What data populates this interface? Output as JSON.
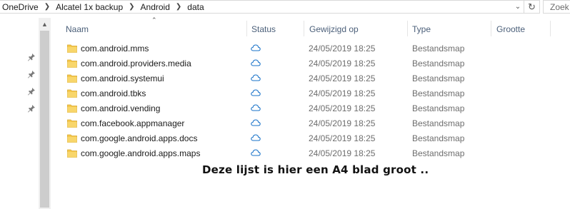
{
  "address": {
    "crumbs": [
      "OneDrive",
      "Alcatel 1x backup",
      "Android",
      "data"
    ]
  },
  "search": {
    "placeholder": "Zoek"
  },
  "columns": {
    "name": "Naam",
    "status": "Status",
    "modified": "Gewijzigd op",
    "type": "Type",
    "size": "Grootte"
  },
  "files": [
    {
      "name": "com.android.mms",
      "modified": "24/05/2019 18:25",
      "type": "Bestandsmap"
    },
    {
      "name": "com.android.providers.media",
      "modified": "24/05/2019 18:25",
      "type": "Bestandsmap"
    },
    {
      "name": "com.android.systemui",
      "modified": "24/05/2019 18:25",
      "type": "Bestandsmap"
    },
    {
      "name": "com.android.tbks",
      "modified": "24/05/2019 18:25",
      "type": "Bestandsmap"
    },
    {
      "name": "com.android.vending",
      "modified": "24/05/2019 18:25",
      "type": "Bestandsmap"
    },
    {
      "name": "com.facebook.appmanager",
      "modified": "24/05/2019 18:25",
      "type": "Bestandsmap"
    },
    {
      "name": "com.google.android.apps.docs",
      "modified": "24/05/2019 18:25",
      "type": "Bestandsmap"
    },
    {
      "name": "com.google.android.apps.maps",
      "modified": "24/05/2019 18:25",
      "type": "Bestandsmap"
    }
  ],
  "annotation": "Deze lijst is  hier een A4 blad groot ..",
  "colors": {
    "folder": "#f5c84c",
    "cloud_status": "#1a73c9",
    "header_text": "#4c607a"
  },
  "icons": {
    "folder": "folder-icon",
    "status": "cloud-icon",
    "pin": "pin-icon",
    "refresh": "refresh-icon",
    "dropdown": "chevron-down-icon"
  }
}
